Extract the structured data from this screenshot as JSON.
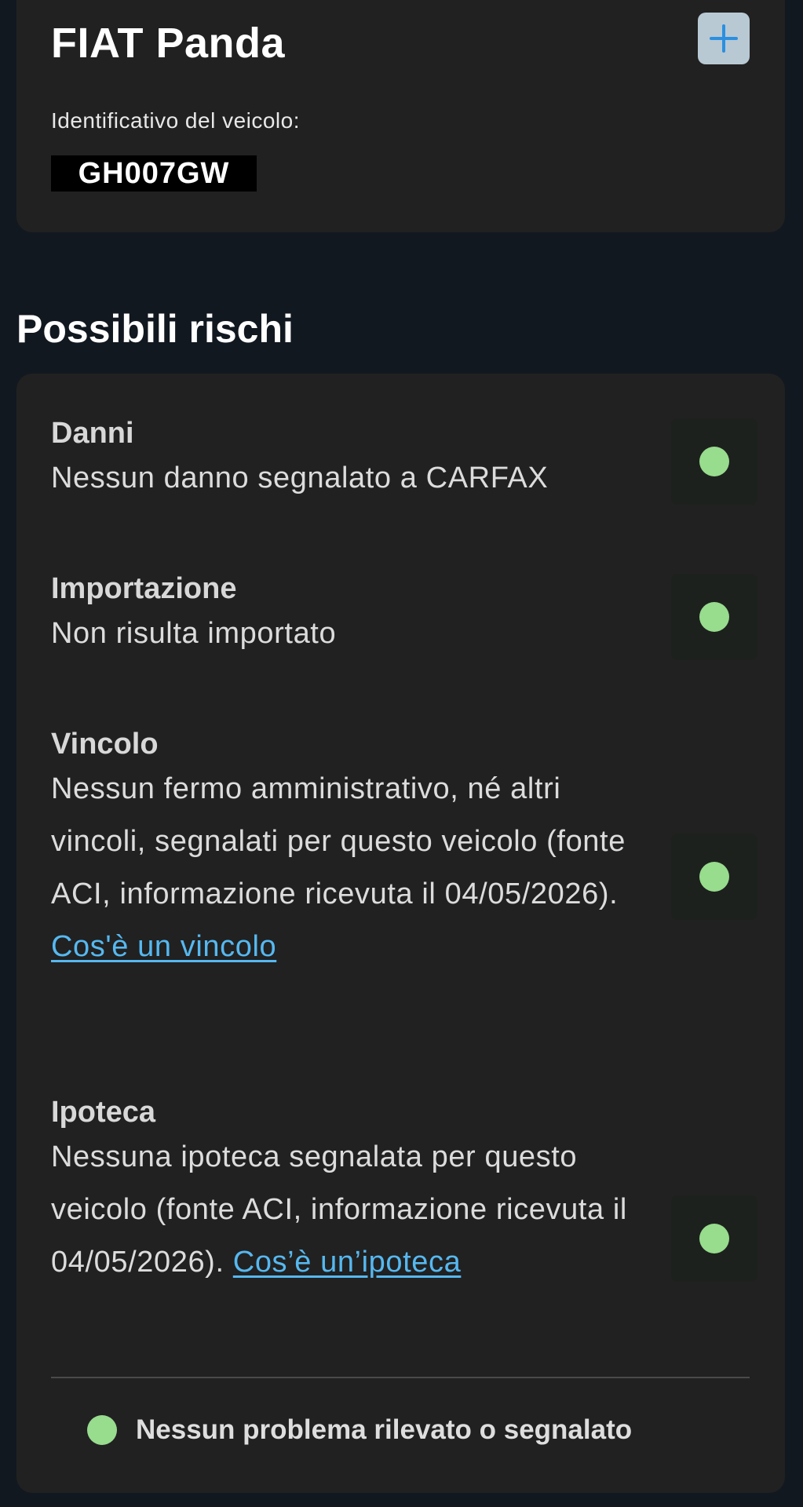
{
  "vehicle": {
    "title": "FIAT Panda",
    "id_label": "Identificativo del veicolo:",
    "plate": "GH007GW"
  },
  "risks": {
    "section_title": "Possibili rischi",
    "items": [
      {
        "title": "Danni",
        "description": "Nessun danno segnalato a CARFAX",
        "status": "ok"
      },
      {
        "title": "Importazione",
        "description": "Non risulta importato",
        "status": "ok"
      },
      {
        "title": "Vincolo",
        "description": "Nessun fermo amministrativo, né altri vincoli, segnalati per questo veicolo (fonte ACI, informazione ricevuta il 04/05/2026).",
        "link": "Cos'è un vincolo",
        "status": "ok"
      },
      {
        "title": "Ipoteca",
        "description": "Nessuna ipoteca segnalata per questo veicolo (fonte ACI, informazione ricevuta il 04/05/2026).",
        "link": "Cos’è un’ipoteca",
        "status": "ok"
      }
    ],
    "legend": "Nessun problema rilevato o segnalato"
  },
  "colors": {
    "status_ok": "#98dc8e",
    "link": "#56b8f0",
    "card_bg": "#212121",
    "page_bg": "#121820"
  }
}
